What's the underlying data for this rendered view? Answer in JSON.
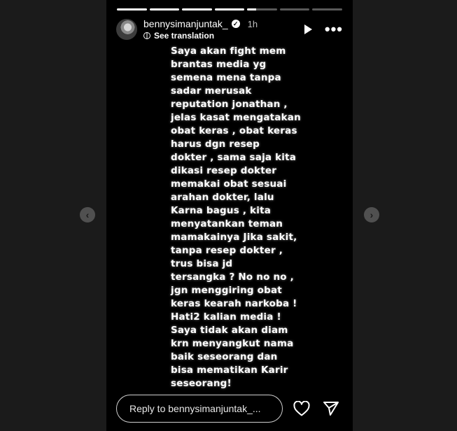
{
  "story": {
    "progress_segments": [
      1,
      1,
      1,
      1,
      0.3,
      0,
      0
    ],
    "username": "bennysimanjuntak_",
    "time": "1h",
    "translation_label": "See translation",
    "text": "Saya akan fight mem\nbrantas media yg\nsemena mena tanpa\nsadar merusak\nreputation jonathan ,\njelas kasat mengatakan\nobat keras , obat keras\nharus dgn resep\ndokter , sama saja kita\ndikasi resep dokter\nmemakai obat sesuai\narahan dokter, lalu\nKarna bagus , kita\nmenyatankan teman\nmamakainya Jika sakit,\ntanpa resep dokter ,\ntrus bisa jd\ntersangka ? No no no ,\njgn menggiring obat\nkeras kearah narkoba !\nHati2 kalian media !\nSaya tidak akan diam\nkrn menyangkut nama\nbaik seseorang dan\nbisa mematikan Karir\nseseorang!",
    "reply_placeholder": "Reply to bennysimanjuntak_..."
  },
  "icons": {
    "verified": "verified-badge-icon",
    "globe": "globe-icon",
    "play": "play-icon",
    "more": "more-options-icon",
    "prev": "chevron-left-icon",
    "next": "chevron-right-icon",
    "like": "heart-icon",
    "send": "send-icon"
  },
  "colors": {
    "background": "#1b1b1b",
    "story_background": "#000000",
    "text": "#ffffff"
  }
}
